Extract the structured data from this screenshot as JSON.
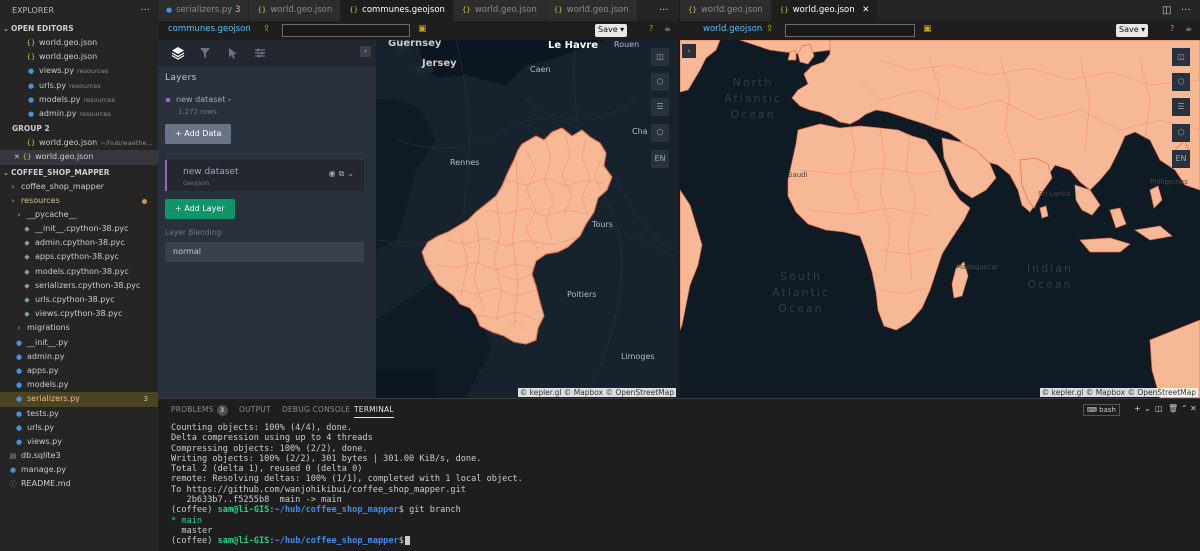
{
  "explorer": {
    "title": "EXPLORER",
    "open_editors_label": "OPEN EDITORS",
    "group2_label": "GROUP 2",
    "project_label": "COFFEE_SHOP_MAPPER",
    "open_editors": [
      {
        "icon": "json",
        "name": "world.geo.json",
        "desc": ""
      },
      {
        "icon": "json",
        "name": "world.geo.json",
        "desc": ""
      },
      {
        "icon": "py",
        "name": "views.py",
        "desc": "resources"
      },
      {
        "icon": "py",
        "name": "urls.py",
        "desc": "resources"
      },
      {
        "icon": "py",
        "name": "models.py",
        "desc": "resources"
      },
      {
        "icon": "py",
        "name": "admin.py",
        "desc": "resources"
      }
    ],
    "group2": [
      {
        "icon": "json",
        "name": "world.geo.json",
        "desc": "~/hub/waethe..."
      },
      {
        "icon": "json",
        "name": "world.geo.json",
        "desc": ""
      }
    ],
    "tree": [
      {
        "icon": "folder",
        "name": "coffee_shop_mapper",
        "badge": ""
      },
      {
        "icon": "folder",
        "name": "resources",
        "badge": ""
      },
      {
        "icon": "folder",
        "name": "__pycache__",
        "badge": ""
      },
      {
        "icon": "pyc",
        "name": "__init__.cpython-38.pyc",
        "badge": ""
      },
      {
        "icon": "pyc",
        "name": "admin.cpython-38.pyc",
        "badge": ""
      },
      {
        "icon": "pyc",
        "name": "apps.cpython-38.pyc",
        "badge": ""
      },
      {
        "icon": "pyc",
        "name": "models.cpython-38.pyc",
        "badge": ""
      },
      {
        "icon": "pyc",
        "name": "serializers.cpython-38.pyc",
        "badge": ""
      },
      {
        "icon": "pyc",
        "name": "urls.cpython-38.pyc",
        "badge": ""
      },
      {
        "icon": "pyc",
        "name": "views.cpython-38.pyc",
        "badge": ""
      },
      {
        "icon": "folder",
        "name": "migrations",
        "badge": ""
      },
      {
        "icon": "py",
        "name": "__init__.py",
        "badge": ""
      },
      {
        "icon": "py",
        "name": "admin.py",
        "badge": ""
      },
      {
        "icon": "py",
        "name": "apps.py",
        "badge": ""
      },
      {
        "icon": "py",
        "name": "models.py",
        "badge": ""
      },
      {
        "icon": "py",
        "name": "serializers.py",
        "badge": "3"
      },
      {
        "icon": "py",
        "name": "tests.py",
        "badge": ""
      },
      {
        "icon": "py",
        "name": "urls.py",
        "badge": ""
      },
      {
        "icon": "py",
        "name": "views.py",
        "badge": ""
      },
      {
        "icon": "db",
        "name": "db.sqlite3",
        "badge": ""
      },
      {
        "icon": "py",
        "name": "manage.py",
        "badge": ""
      },
      {
        "icon": "md",
        "name": "README.md",
        "badge": ""
      }
    ]
  },
  "tabs_left": [
    {
      "name": "serializers.py",
      "num": "3"
    },
    {
      "name": "world.geo.json",
      "num": ""
    },
    {
      "name": "communes.geojson",
      "num": ""
    },
    {
      "name": "world.geo.json",
      "num": ""
    },
    {
      "name": "world.geo.json",
      "num": ""
    }
  ],
  "tabs_right": [
    {
      "name": "world.geo.json"
    },
    {
      "name": "world.geo.json"
    }
  ],
  "toolbar_left": {
    "file": "communes.geojson",
    "save": "Save",
    "help": "?"
  },
  "toolbar_right": {
    "file": "world.geojson",
    "save": "Save",
    "help": "?"
  },
  "kepler": {
    "layers_title": "Layers",
    "dataset_name": "new dataset",
    "dataset_rows": "1,272 rows",
    "add_data": "Add Data",
    "layer_name": "new dataset",
    "layer_type": "Geojson",
    "add_layer": "Add Layer",
    "blending_label": "Layer Blending",
    "blending_value": "normal",
    "lang": "EN",
    "attribution": "© kepler.gl © Mapbox © OpenStreetMap"
  },
  "map_left_labels": {
    "guernsey": "Guernsey",
    "jersey": "Jersey",
    "le_havre": "Le Havre",
    "rouen": "Rouen",
    "caen": "Caen",
    "rennes": "Rennes",
    "tours": "Tours",
    "poitiers": "Poitiers",
    "limoges": "Limoges",
    "cha": "Cha"
  },
  "map_right_labels": {
    "north_atlantic": "North Atlantic Ocean",
    "south_atlantic": "South Atlantic Ocean",
    "indian": "Indian Ocean",
    "madagascar": "Madagascar",
    "sri_lanka": "Sri Lanka",
    "philippines": "Philippines",
    "saudi": "Saudi"
  },
  "panel": {
    "problems": "PROBLEMS",
    "problems_count": "3",
    "output": "OUTPUT",
    "debug": "DEBUG CONSOLE",
    "terminal": "TERMINAL",
    "shell": "bash"
  },
  "terminal": {
    "lines": [
      "Counting objects: 100% (4/4), done.",
      "Delta compression using up to 4 threads",
      "Compressing objects: 100% (2/2), done.",
      "Writing objects: 100% (2/2), 301 bytes | 301.00 KiB/s, done.",
      "Total 2 (delta 1), reused 0 (delta 0)",
      "remote: Resolving deltas: 100% (1/1), completed with 1 local object.",
      "To https://github.com/wanjohikibui/coffee_shop_mapper.git",
      "   2b633b7..f5255b8  main -> main"
    ],
    "env": "(coffee)",
    "user": "sam@li-GIS",
    "path": "~/hub/coffee_shop_mapper",
    "cmd": "git branch",
    "branch_current": "* main",
    "branch_other": "  master"
  },
  "colors": {
    "land": "#f7b896",
    "land_stroke": "#e0714f",
    "water": "#0e1a24",
    "kepler_panel": "#29323c",
    "add_layer": "#0f9668",
    "layer_accent": "#a35fc3"
  }
}
